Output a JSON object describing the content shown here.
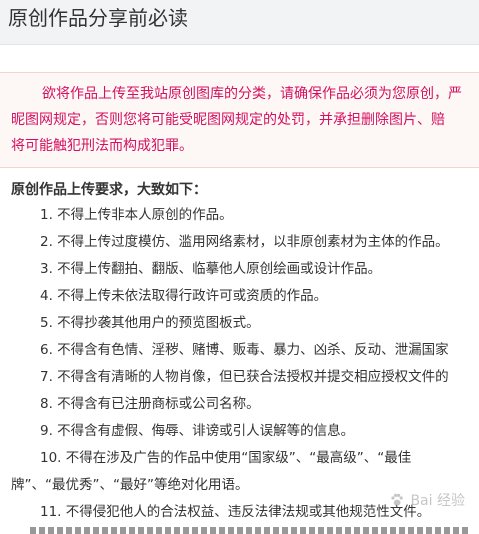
{
  "header": {
    "title": "原创作品分享前必读"
  },
  "notice": {
    "line1": "欲将作品上传至我站原创图库的分类，请确保作品必须为您原创，严",
    "line2": "昵图网规定，否则您将可能受昵图网规定的处罚，并承担删除图片、赔",
    "line3": "将可能触犯刑法而构成犯罪。"
  },
  "requirements": {
    "heading": "原创作品上传要求，大致如下：",
    "items": [
      "1. 不得上传非本人原创的作品。",
      "2. 不得上传过度模仿、滥用网络素材，以非原创素材为主体的作品。",
      "3. 不得上传翻拍、翻版、临摹他人原创绘画或设计作品。",
      "4. 不得上传未依法取得行政许可或资质的作品。",
      "5. 不得抄袭其他用户的预览图板式。",
      "6. 不得含有色情、淫秽、赌博、贩毒、暴力、凶杀、反动、泄漏国家",
      "7. 不得含有清晰的人物肖像，但已获合法授权并提交相应授权文件的",
      "8. 不得含有已注册商标或公司名称。",
      "9. 不得含有虚假、侮辱、诽谤或引人误解等的信息。",
      "10. 不得在涉及广告的作品中使用“国家级”、“最高级”、“最佳",
      "牌”、“最优秀”、“最好”等绝对化用语。",
      "11. 不得侵犯他人的合法权益、违反法律法规或其他规范性文件。"
    ]
  },
  "watermark": {
    "text": "Bai 经验"
  }
}
